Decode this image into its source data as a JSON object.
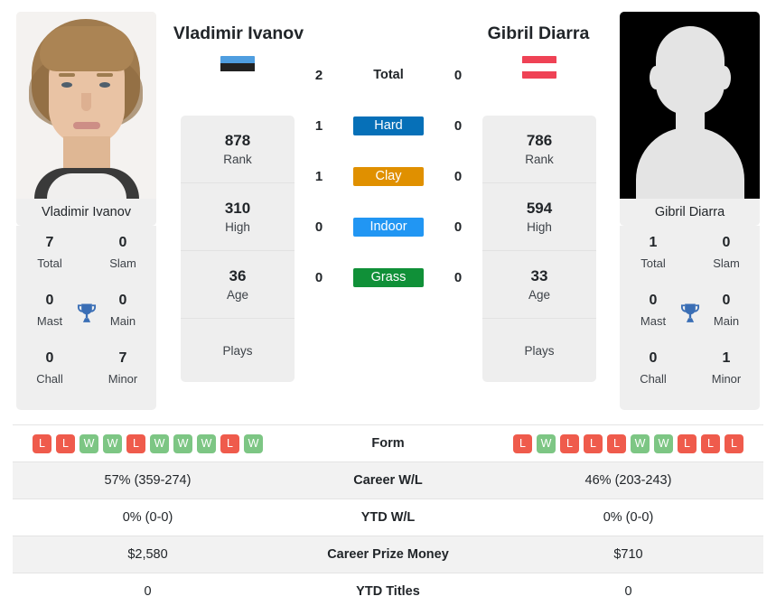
{
  "players": {
    "left": {
      "name": "Vladimir Ivanov",
      "photo_caption": "Vladimir Ivanov",
      "flag_name": "estonia-flag",
      "flag_colors": [
        "#4f9ee0",
        "#222222",
        "#ffffff"
      ],
      "titles": {
        "total_value": "7",
        "total_label": "Total",
        "slam_value": "0",
        "slam_label": "Slam",
        "mast_value": "0",
        "mast_label": "Mast",
        "main_value": "0",
        "main_label": "Main",
        "chall_value": "0",
        "chall_label": "Chall",
        "minor_value": "7",
        "minor_label": "Minor"
      },
      "stats": [
        {
          "value": "878",
          "label": "Rank"
        },
        {
          "value": "310",
          "label": "High"
        },
        {
          "value": "36",
          "label": "Age"
        },
        {
          "value": "",
          "label": "Plays"
        }
      ],
      "surface_wins": {
        "total": "2",
        "hard": "1",
        "clay": "1",
        "indoor": "0",
        "grass": "0"
      },
      "form": [
        "L",
        "L",
        "W",
        "W",
        "L",
        "W",
        "W",
        "W",
        "L",
        "W"
      ],
      "career_wl": "57% (359-274)",
      "ytd_wl": "0% (0-0)",
      "career_prize_money": "$2,580",
      "ytd_titles": "0"
    },
    "right": {
      "name": "Gibril Diarra",
      "photo_caption": "Gibril Diarra",
      "flag_name": "austria-flag",
      "flag_colors": [
        "#ef4255",
        "#ffffff",
        "#ef4255"
      ],
      "titles": {
        "total_value": "1",
        "total_label": "Total",
        "slam_value": "0",
        "slam_label": "Slam",
        "mast_value": "0",
        "mast_label": "Mast",
        "main_value": "0",
        "main_label": "Main",
        "chall_value": "0",
        "chall_label": "Chall",
        "minor_value": "1",
        "minor_label": "Minor"
      },
      "stats": [
        {
          "value": "786",
          "label": "Rank"
        },
        {
          "value": "594",
          "label": "High"
        },
        {
          "value": "33",
          "label": "Age"
        },
        {
          "value": "",
          "label": "Plays"
        }
      ],
      "surface_wins": {
        "total": "0",
        "hard": "0",
        "clay": "0",
        "indoor": "0",
        "grass": "0"
      },
      "form": [
        "L",
        "W",
        "L",
        "L",
        "L",
        "W",
        "W",
        "L",
        "L",
        "L"
      ],
      "career_wl": "46% (203-243)",
      "ytd_wl": "0% (0-0)",
      "career_prize_money": "$710",
      "ytd_titles": "0"
    }
  },
  "surfaces": [
    {
      "key": "total",
      "label": "Total",
      "color": ""
    },
    {
      "key": "hard",
      "label": "Hard",
      "color": "#0670b8"
    },
    {
      "key": "clay",
      "label": "Clay",
      "color": "#e09000"
    },
    {
      "key": "indoor",
      "label": "Indoor",
      "color": "#2196f3"
    },
    {
      "key": "grass",
      "label": "Grass",
      "color": "#109038"
    }
  ],
  "table_rows": [
    {
      "label": "Form",
      "left": "",
      "right": ""
    },
    {
      "label": "Career W/L",
      "left": "57% (359-274)",
      "right": "46% (203-243)"
    },
    {
      "label": "YTD W/L",
      "left": "0% (0-0)",
      "right": "0% (0-0)"
    },
    {
      "label": "Career Prize Money",
      "left": "$2,580",
      "right": "$710"
    },
    {
      "label": "YTD Titles",
      "left": "0",
      "right": "0"
    }
  ],
  "colors": {
    "win_badge": "#7dc684",
    "loss_badge": "#ef5b4c",
    "trophy": "#3a6eb5",
    "panel_bg": "#efefef"
  }
}
